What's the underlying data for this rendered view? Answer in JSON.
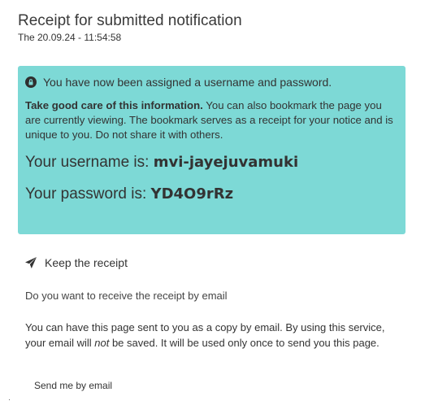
{
  "header": {
    "title": "Receipt for submitted notification",
    "timestamp": "The 20.09.24 - 11:54:58"
  },
  "notice": {
    "icon": "lock-icon",
    "background": "#7dd9d6",
    "headline": "You have now been assigned a username and password.",
    "emphasis": "Take good care of this information.",
    "body": " You can also bookmark the page you are currently viewing. The bookmark serves as a receipt for your notice and is unique to you. Do not share it with others.",
    "username_label": "Your username is: ",
    "username": "mvi-jayejuvamuki",
    "password_label": "Your password is: ",
    "password": "YD4O9rRz"
  },
  "receipt": {
    "icon": "paper-plane-icon",
    "heading": "Keep the receipt",
    "question": "Do you want to receive the receipt by email",
    "explain_part1": "You can have this page sent to you as a copy by email. By using this service, your email will ",
    "explain_not": "not",
    "explain_part2": " be saved. It will be used only once to send you this page.",
    "send_button": "Send me by email"
  }
}
